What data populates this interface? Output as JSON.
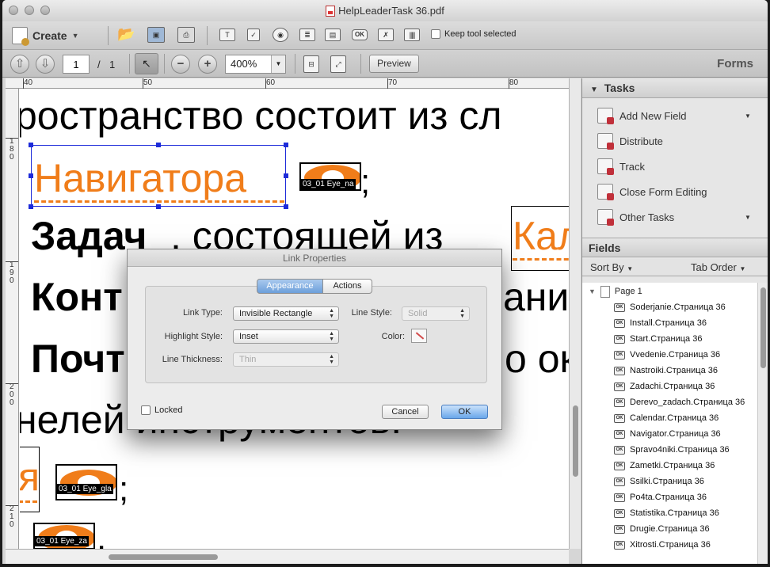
{
  "window": {
    "title": "HelpLeaderTask 36.pdf"
  },
  "toolbar": {
    "create_label": "Create",
    "keep_tool_label": "Keep tool selected",
    "icons": [
      "open-icon",
      "save-icon",
      "print-icon",
      "text-field-icon",
      "checkbox-icon",
      "radio-icon",
      "list-box-icon",
      "dropdown-icon",
      "ok-button-icon",
      "digital-signature-icon",
      "barcode-icon"
    ]
  },
  "nav": {
    "page_value": "1",
    "page_separator": "/",
    "page_total": "1",
    "zoom_value": "400%",
    "preview_label": "Preview",
    "mode_label": "Forms"
  },
  "ruler": {
    "h_labels": [
      "40",
      "50",
      "60",
      "70",
      "80"
    ],
    "v_labels": [
      "1\n8\n0",
      "1\n9\n0",
      "2\n0\n0",
      "2\n1\n0"
    ]
  },
  "document": {
    "line1": "ространство состоит из сл",
    "field_navigator": "Навигатора",
    "semicolon": ";",
    "line3_bold": "Задач",
    "line3_rest": ", состоящей из",
    "field_kal": "Кал",
    "line4_start": "Конт",
    "line4_end": "ани",
    "line5_start": "Почт",
    "line5_end": "о ок",
    "line6": "нелей инструментов.",
    "field_ya": "я",
    "semicolon2": ";",
    "period": ".",
    "eye_labels": [
      "03_01 Eye_na",
      "03_01 Eye_gla",
      "03_01 Eye_za"
    ]
  },
  "panel": {
    "tasks_header": "Tasks",
    "tasks": [
      {
        "label": "Add New Field",
        "has_arrow": true
      },
      {
        "label": "Distribute",
        "has_arrow": false
      },
      {
        "label": "Track",
        "has_arrow": false
      },
      {
        "label": "Close Form Editing",
        "has_arrow": false
      },
      {
        "label": "Other Tasks",
        "has_arrow": true
      }
    ],
    "fields_header": "Fields",
    "sort_by": "Sort By",
    "tab_order": "Tab Order",
    "page_node": "Page 1",
    "fields": [
      "Soderjanie.Страница 36",
      "Install.Страница 36",
      "Start.Страница 36",
      "Vvedenie.Страница 36",
      "Nastroiki.Страница 36",
      "Zadachi.Страница 36",
      "Derevo_zadach.Страница 36",
      "Calendar.Страница 36",
      "Navigator.Страница 36",
      "Spravo4niki.Страница 36",
      "Zametki.Страница 36",
      "Ssilki.Страница 36",
      "Po4ta.Страница 36",
      "Statistika.Страница 36",
      "Drugie.Страница 36",
      "Xitrosti.Страница 36"
    ],
    "ok_badge": "OK"
  },
  "dialog": {
    "title": "Link Properties",
    "tab_appearance": "Appearance",
    "tab_actions": "Actions",
    "link_type_label": "Link Type:",
    "link_type_value": "Invisible Rectangle",
    "line_style_label": "Line Style:",
    "line_style_value": "Solid",
    "highlight_style_label": "Highlight Style:",
    "highlight_style_value": "Inset",
    "color_label": "Color:",
    "line_thickness_label": "Line Thickness:",
    "line_thickness_value": "Thin",
    "locked_label": "Locked",
    "cancel_label": "Cancel",
    "ok_label": "OK"
  },
  "colors": {
    "accent_orange": "#f07d1a",
    "selection_blue": "#1d2bd9",
    "default_button": "#6aa7ea"
  }
}
